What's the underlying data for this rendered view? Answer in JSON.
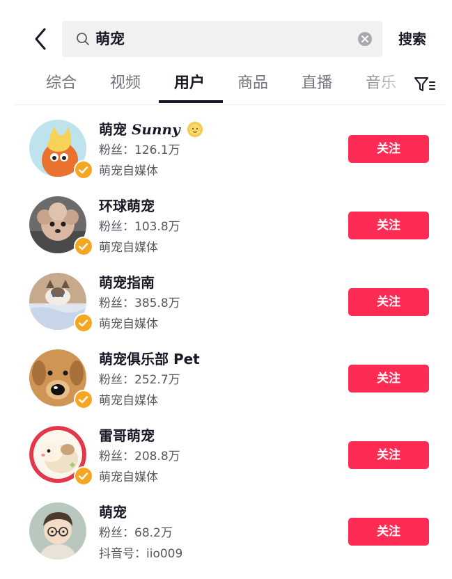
{
  "search": {
    "query": "萌宠",
    "submit_label": "搜索"
  },
  "tabs": [
    {
      "label": "综合",
      "active": false
    },
    {
      "label": "视频",
      "active": false
    },
    {
      "label": "用户",
      "active": true
    },
    {
      "label": "商品",
      "active": false
    },
    {
      "label": "直播",
      "active": false
    },
    {
      "label": "音乐",
      "active": false
    }
  ],
  "users": [
    {
      "name": "萌宠",
      "name_deco": "Sunny",
      "has_sun_emoji": true,
      "fans": "粉丝：126.1万",
      "info": "萌宠自媒体",
      "verified": true,
      "follow_label": "关注",
      "avatar": "cartoon-cat-avatar"
    },
    {
      "name": "环球萌宠",
      "fans": "粉丝：103.8万",
      "info": "萌宠自媒体",
      "verified": true,
      "follow_label": "关注",
      "avatar": "poodle-dog-avatar"
    },
    {
      "name": "萌宠指南",
      "fans": "粉丝：385.8万",
      "info": "萌宠自媒体",
      "verified": true,
      "follow_label": "关注",
      "avatar": "ragdoll-cat-avatar"
    },
    {
      "name": "萌宠俱乐部 Pet",
      "fans": "粉丝：252.7万",
      "info": "萌宠自媒体",
      "verified": true,
      "follow_label": "关注",
      "avatar": "cartoon-dog-avatar"
    },
    {
      "name": "雷哥萌宠",
      "fans": "粉丝：208.8万",
      "info": "萌宠自媒体",
      "verified": true,
      "follow_label": "关注",
      "avatar": "guinea-pig-avatar"
    },
    {
      "name": "萌宠",
      "fans": "粉丝：68.2万",
      "info": "抖音号：iio009",
      "verified": false,
      "follow_label": "关注",
      "avatar": "cartoon-boy-avatar"
    }
  ],
  "colors": {
    "follow_button": "#fe2c55",
    "verified_badge": "#f5a623",
    "search_bg": "#f1f1f2"
  }
}
